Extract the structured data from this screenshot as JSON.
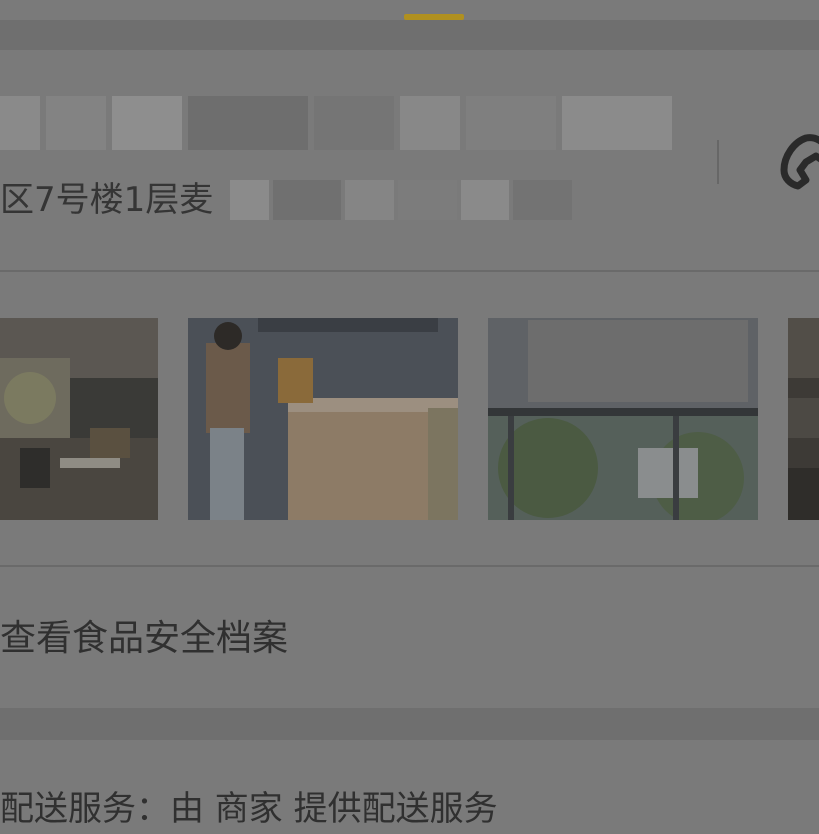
{
  "store": {
    "address_visible": "区7号楼1层",
    "address_cut": "麦"
  },
  "photos": [
    {
      "icon": "restaurant-interior-photo"
    },
    {
      "icon": "counter-photo"
    },
    {
      "icon": "storefront-window-photo"
    },
    {
      "icon": "restaurant-interior-photo-partial"
    }
  ],
  "links": {
    "food_safety": "查看食品安全档案"
  },
  "delivery": {
    "text": "配送服务：由 商家 提供配送服务"
  },
  "colors": {
    "overlay_bg": "#7a7a7a",
    "accent_indicator": "#b0901f"
  }
}
